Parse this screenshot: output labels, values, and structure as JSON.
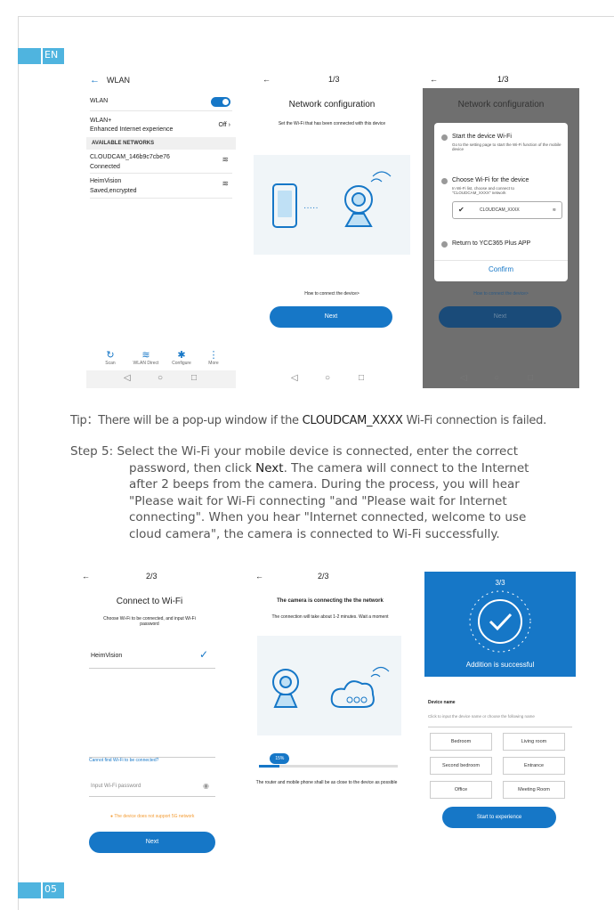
{
  "lang": "EN",
  "page_number": "05",
  "screen1": {
    "title": "WLAN",
    "wlan_label": "WLAN",
    "wlan_plus": "WLAN+",
    "wlan_plus_sub": "Enhanced Internet experience",
    "wlan_plus_state": "Off",
    "section": "AVAILABLE NETWORKS",
    "net1_name": "CLOUDCAM_146b9c7cbe76",
    "net1_status": "Connected",
    "net2_name": "HeimVision",
    "net2_status": "Saved,encrypted",
    "toolbar": [
      "Scan",
      "WLAN Direct",
      "Configure",
      "More"
    ]
  },
  "screen2": {
    "step": "1/3",
    "title": "Network configuration",
    "desc": "Set the Wi-Fi that has been connected with this device",
    "link": "How to connect the device>",
    "button": "Next"
  },
  "screen3": {
    "step": "1/3",
    "title": "Network configuration",
    "item1": "Start the device Wi-Fi",
    "item1_sub": "Go to the setting page to start the Wi-Fi function of the mobile device",
    "item2": "Choose Wi-Fi for the device",
    "item2_sub": "In Wi-Fi list, choose and connect to \"CLOUDCAM_XXXX\" network",
    "item2_net": "CLOUDCAM_XXXX",
    "item3": "Return to YCC365 Plus APP",
    "confirm": "Confirm",
    "link": "How to connect the device>",
    "button": "Next"
  },
  "tip": {
    "prefix": "Tip：There will be a pop-up window if the ",
    "bold": "CLOUDCAM_XXXX",
    "suffix": " Wi-Fi  connection is failed."
  },
  "step5": {
    "line1": "Step 5: Select the Wi-Fi your mobile device is connected, enter the correct",
    "line2a": "password, then click ",
    "line2b": "Next",
    "line2c": ". The camera will connect to the Internet",
    "line3": "after 2 beeps from the camera. During the process, you will hear",
    "line4": "\"Please wait for Wi-Fi connecting \"and \"Please wait for Internet",
    "line5": "connecting\". When you hear \"Internet connected, welcome to use",
    "line6": "cloud camera\", the camera is connected to Wi-Fi successfully."
  },
  "screen4": {
    "step": "2/3",
    "title": "Connect to Wi-Fi",
    "desc": "Choose Wi-Fi to be connected, and input Wi-Fi password",
    "network": "HeimVision",
    "link": "Cannot find Wi-Fi to be connected?",
    "password_placeholder": "Input Wi-Fi password",
    "warning": "The device does not support 5G network",
    "button": "Next"
  },
  "screen5": {
    "step": "2/3",
    "title": "The camera is connecting the the network",
    "desc": "The connection will take about 1-2 minutes. Wait a moment",
    "progress_label": "15%",
    "progress": 0.15,
    "note": "The router and mobile phone shall be as close to the device as possible"
  },
  "screen6": {
    "step": "3/3",
    "success": "Addition is successful",
    "device_name_label": "Device name",
    "placeholder": "Click to input the device name or choose the following name",
    "names": [
      "Bedroom",
      "Living room",
      "Second bedroom",
      "Entrance",
      "Office",
      "Meeting Room"
    ],
    "button": "Start to experience"
  },
  "colors": {
    "accent": "#1677c7",
    "tab": "#4fb4df",
    "warning": "#f39c34"
  }
}
